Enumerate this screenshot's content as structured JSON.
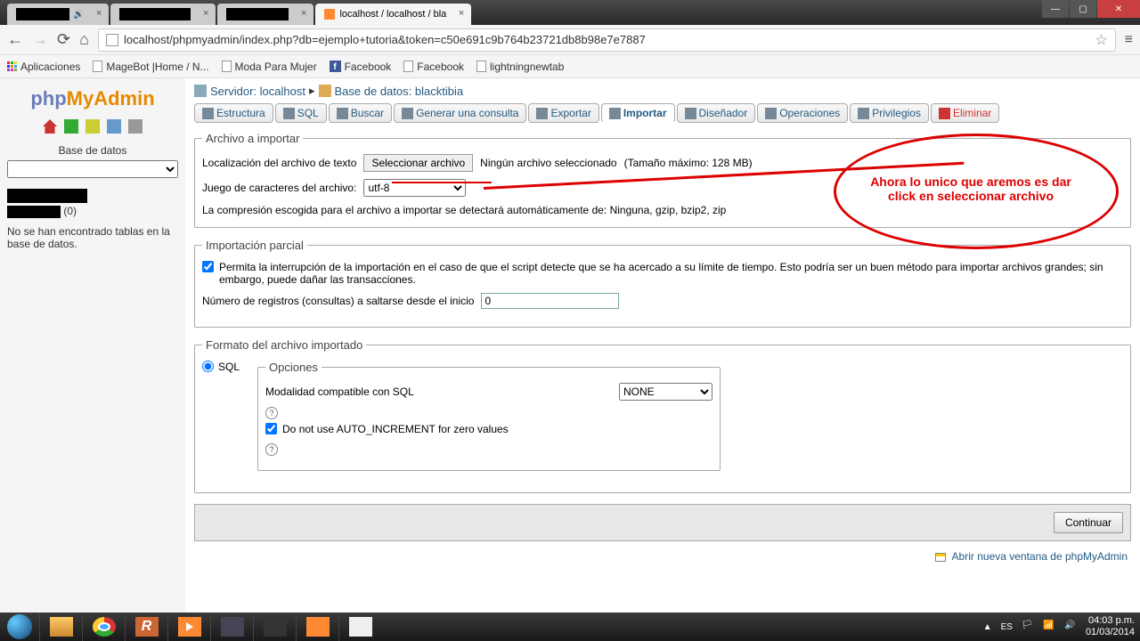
{
  "browser": {
    "tabs": [
      {
        "title": "",
        "audio": true
      },
      {
        "title": ""
      },
      {
        "title": ""
      },
      {
        "title": "localhost / localhost / bla",
        "active": true
      }
    ],
    "url": "localhost/phpmyadmin/index.php?db=ejemplo+tutoria&token=c50e691c9b764b23721db8b98e7e7887",
    "bookmarks": {
      "apps": "Aplicaciones",
      "items": [
        "MageBot |Home / N...",
        "Moda Para Mujer",
        "Facebook",
        "Facebook",
        "lightningnewtab"
      ]
    }
  },
  "sidebar": {
    "logo": {
      "php": "php",
      "my": "My",
      "admin": "Admin"
    },
    "db_label": "Base de datos",
    "db_count": "(0)",
    "no_tables": "No se han encontrado tablas en la base de datos."
  },
  "breadcrumb": {
    "server_label": "Servidor:",
    "server_name": "localhost",
    "db_label": "Base de datos:",
    "db_name": "blacktibia"
  },
  "tabs": {
    "estructura": "Estructura",
    "sql": "SQL",
    "buscar": "Buscar",
    "generar": "Generar una consulta",
    "exportar": "Exportar",
    "importar": "Importar",
    "disenador": "Diseñador",
    "operaciones": "Operaciones",
    "privilegios": "Privilegios",
    "eliminar": "Eliminar"
  },
  "import_section": {
    "legend": "Archivo a importar",
    "file_label": "Localización del archivo de texto",
    "select_file_btn": "Seleccionar archivo",
    "no_file": "Ningún archivo seleccionado",
    "max_size": "(Tamaño máximo: 128 MB)",
    "charset_label": "Juego de caracteres del archivo:",
    "charset_value": "utf-8",
    "compression_note": "La compresión escogida para el archivo a importar se detectará automáticamente de: Ninguna, gzip, bzip2, zip"
  },
  "partial_section": {
    "legend": "Importación parcial",
    "checkbox_label": "Permita la interrupción de la importación en el caso de que el script detecte que se ha acercado a su límite de tiempo. Esto podría ser un buen método para importar archivos grandes; sin embargo, puede dañar las transacciones.",
    "skip_label": "Número de registros (consultas) a saltarse desde el inicio",
    "skip_value": "0"
  },
  "format_section": {
    "legend": "Formato del archivo importado",
    "sql_label": "SQL",
    "options_legend": "Opciones",
    "mode_label": "Modalidad compatible con SQL",
    "mode_value": "NONE",
    "auto_increment": "Do not use AUTO_INCREMENT for zero values"
  },
  "submit_btn": "Continuar",
  "footer_link": "Abrir nueva ventana de phpMyAdmin",
  "annotation": {
    "text": "Ahora lo unico que aremos es dar click en seleccionar archivo"
  },
  "taskbar": {
    "lang": "ES",
    "time": "04:03 p.m.",
    "date": "01/03/2014"
  }
}
